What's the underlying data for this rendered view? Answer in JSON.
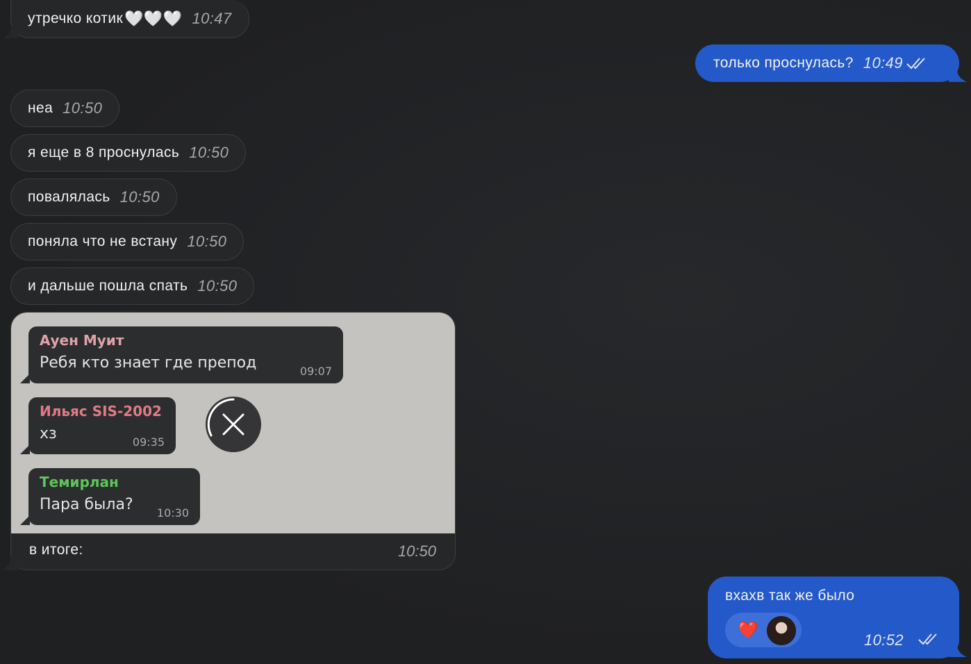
{
  "colors": {
    "background": "#212224",
    "incoming_bubble": "#262729",
    "outgoing_bubble": "#2459c9",
    "screenshot_bg": "#c4c3bf",
    "name_pink": "#e0a2a9",
    "name_red": "#e07b86",
    "name_green": "#5fc45a"
  },
  "messages": [
    {
      "text": "утречко котик",
      "emoji": "🤍🤍🤍",
      "time": "10:47"
    },
    {
      "text": "только проснулась?",
      "time": "10:49"
    },
    {
      "text": "неа",
      "time": "10:50"
    },
    {
      "text": "я еще в 8 проснулась",
      "time": "10:50"
    },
    {
      "text": "повалялась",
      "time": "10:50"
    },
    {
      "text": "поняла что не встану",
      "time": "10:50"
    },
    {
      "text": "и дальше пошла спать",
      "time": "10:50"
    },
    {
      "text": "вхахв так же было",
      "time": "10:52",
      "reaction": "❤️"
    }
  ],
  "image_message": {
    "caption": "в итоге:",
    "time": "10:50",
    "screenshot": [
      {
        "name": "Ауен Муит",
        "text": "Ребя кто знает где препод",
        "time": "09:07"
      },
      {
        "name": "Ильяс SIS-2002",
        "text": "хз",
        "time": "09:35"
      },
      {
        "name": "Темирлан",
        "text": "Пара была?",
        "time": "10:30"
      }
    ]
  }
}
